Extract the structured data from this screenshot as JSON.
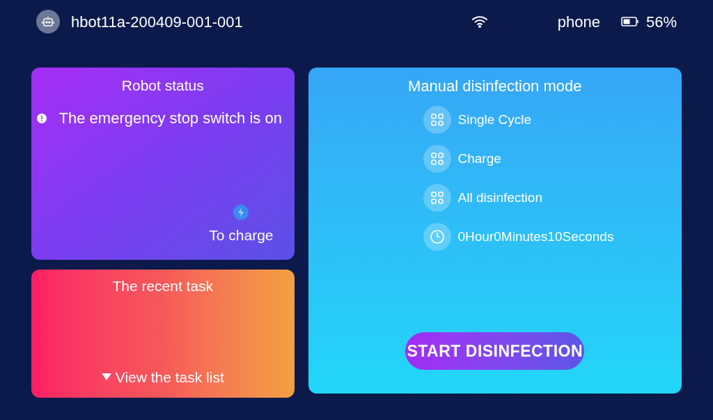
{
  "header": {
    "device_name": "hbot11a-200409-001-001",
    "network": "phone",
    "battery": "56%"
  },
  "robot_status": {
    "title": "Robot status",
    "message": "The emergency stop switch is on",
    "action": "To charge"
  },
  "recent_task": {
    "title": "The recent task",
    "link": "View the task list"
  },
  "manual_mode": {
    "title": "Manual disinfection mode",
    "options": [
      {
        "kind": "mode",
        "label": "Single Cycle"
      },
      {
        "kind": "mode",
        "label": "Charge"
      },
      {
        "kind": "mode",
        "label": "All disinfection"
      },
      {
        "kind": "timer",
        "label": "0Hour0Minutes10Seconds"
      }
    ],
    "button": "START DISINFECTION"
  }
}
